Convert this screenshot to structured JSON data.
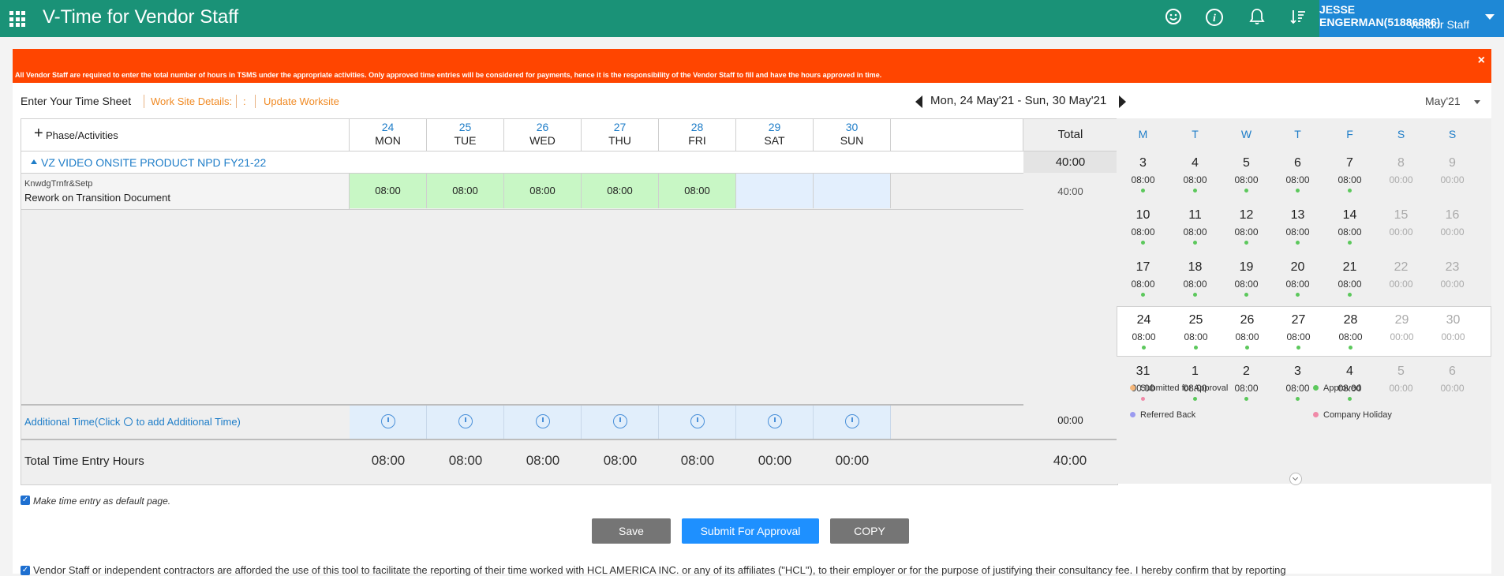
{
  "header": {
    "title": "V-Time for Vendor Staff",
    "user_name": "JESSE ENGERMAN(51886886)",
    "user_role": "Vendor Staff",
    "icons": [
      "apps-grid-icon",
      "smiley-icon",
      "info-icon",
      "bell-icon",
      "sort-icon"
    ]
  },
  "banner": {
    "text": "All Vendor Staff are required to enter the total number of hours in TSMS under the appropriate activities. Only approved time entries will be considered for payments, hence it is the responsibility of the Vendor Staff to fill and have the hours approved in time.",
    "close_label": "×"
  },
  "subheader": {
    "title": "Enter Your Time Sheet",
    "worksite_label": "Work Site Details:",
    "colon": ":",
    "update_label": "Update Worksite",
    "week_range": "Mon, 24 May'21 - Sun, 30 May'21",
    "month": "May'21"
  },
  "grid": {
    "phase_label": "Phase/Activities",
    "total_label": "Total",
    "days": [
      {
        "num": "24",
        "name": "MON"
      },
      {
        "num": "25",
        "name": "TUE"
      },
      {
        "num": "26",
        "name": "WED"
      },
      {
        "num": "27",
        "name": "THU"
      },
      {
        "num": "28",
        "name": "FRI"
      },
      {
        "num": "29",
        "name": "SAT"
      },
      {
        "num": "30",
        "name": "SUN"
      }
    ],
    "project": {
      "name": "VZ VIDEO ONSITE PRODUCT NPD FY21-22",
      "total": "40:00"
    },
    "activity": {
      "code": "KnwdgTrnfr&Setp",
      "name": "Rework on Transition Document",
      "hours": [
        "08:00",
        "08:00",
        "08:00",
        "08:00",
        "08:00",
        "",
        ""
      ],
      "total": "40:00"
    },
    "additional": {
      "label_pre": "Additional Time(Click",
      "label_post": "to add Additional Time)",
      "total": "00:00"
    },
    "totals": {
      "label": "Total Time Entry Hours",
      "values": [
        "08:00",
        "08:00",
        "08:00",
        "08:00",
        "08:00",
        "00:00",
        "00:00"
      ],
      "grand": "40:00"
    }
  },
  "calendar": {
    "headers": [
      "M",
      "T",
      "W",
      "T",
      "F",
      "S",
      "S"
    ],
    "weeks": [
      {
        "days": [
          [
            "3",
            "08:00"
          ],
          [
            "4",
            "08:00"
          ],
          [
            "5",
            "08:00"
          ],
          [
            "6",
            "08:00"
          ],
          [
            "7",
            "08:00"
          ],
          [
            "8",
            "00:00"
          ],
          [
            "9",
            "00:00"
          ]
        ]
      },
      {
        "days": [
          [
            "10",
            "08:00"
          ],
          [
            "11",
            "08:00"
          ],
          [
            "12",
            "08:00"
          ],
          [
            "13",
            "08:00"
          ],
          [
            "14",
            "08:00"
          ],
          [
            "15",
            "00:00"
          ],
          [
            "16",
            "00:00"
          ]
        ]
      },
      {
        "days": [
          [
            "17",
            "08:00"
          ],
          [
            "18",
            "08:00"
          ],
          [
            "19",
            "08:00"
          ],
          [
            "20",
            "08:00"
          ],
          [
            "21",
            "08:00"
          ],
          [
            "22",
            "00:00"
          ],
          [
            "23",
            "00:00"
          ]
        ]
      },
      {
        "days": [
          [
            "24",
            "08:00"
          ],
          [
            "25",
            "08:00"
          ],
          [
            "26",
            "08:00"
          ],
          [
            "27",
            "08:00"
          ],
          [
            "28",
            "08:00"
          ],
          [
            "29",
            "00:00"
          ],
          [
            "30",
            "00:00"
          ]
        ]
      },
      {
        "days": [
          [
            "31",
            "00:00"
          ],
          [
            "1",
            "08:00"
          ],
          [
            "2",
            "08:00"
          ],
          [
            "3",
            "08:00"
          ],
          [
            "4",
            "08:00"
          ],
          [
            "5",
            "00:00"
          ],
          [
            "6",
            "00:00"
          ]
        ]
      }
    ],
    "legend": [
      "Submitted for Approval",
      "Approved",
      "Referred Back",
      "Company Holiday"
    ],
    "colors": {
      "approved": "#5cc85c",
      "submitted": "#f5b77a",
      "referred": "#9b9bf0",
      "holiday": "#f08aa8"
    }
  },
  "footer": {
    "default_label": "Make time entry as default page.",
    "save_label": "Save",
    "submit_label": "Submit For Approval",
    "copy_label": "COPY",
    "disclaimer": "Vendor Staff or independent contractors are afforded the use of this tool to facilitate the reporting of their time worked with HCL AMERICA INC. or any of its affiliates (\"HCL\"), to their employer or for the purpose of justifying their consultancy fee. I hereby confirm that by reporting"
  },
  "colors": {
    "brand": "#1a9277",
    "user_box": "#1e88d6",
    "banner": "#ff4500",
    "link": "#1e7dc8",
    "accent": "#f08a24"
  }
}
